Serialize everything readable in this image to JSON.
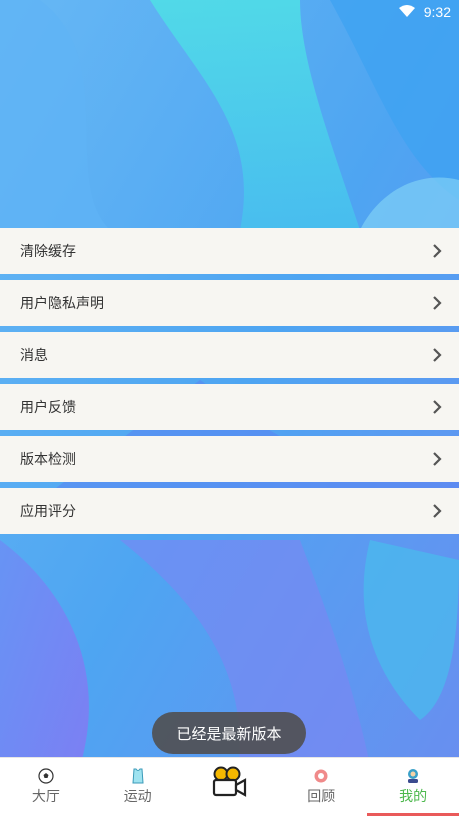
{
  "status": {
    "time": "9:32",
    "wifi_icon": "wifi-icon"
  },
  "menu": [
    {
      "label": "清除缓存"
    },
    {
      "label": "用户隐私声明"
    },
    {
      "label": "消息"
    },
    {
      "label": "用户反馈"
    },
    {
      "label": "版本检测"
    },
    {
      "label": "应用评分"
    }
  ],
  "toast": {
    "text": "已经是最新版本"
  },
  "tabbar": {
    "tabs": [
      {
        "label": "大厅",
        "icon": "soccer-ball-icon"
      },
      {
        "label": "运动",
        "icon": "jersey-icon"
      },
      {
        "label": "",
        "icon": "video-camera-icon"
      },
      {
        "label": "回顾",
        "icon": "lifebuoy-icon"
      },
      {
        "label": "我的",
        "icon": "user-icon"
      }
    ],
    "active_color": "#4cb84c",
    "indicator_color": "#e95a5a"
  }
}
